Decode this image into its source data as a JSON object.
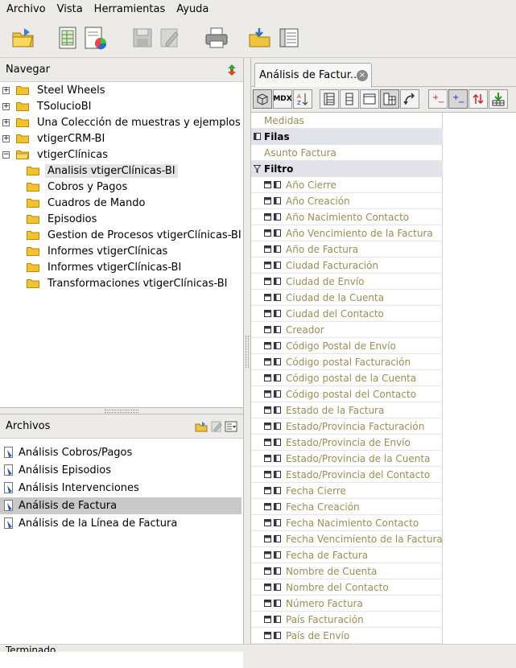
{
  "menubar": {
    "items": [
      "Archivo",
      "Vista",
      "Herramientas",
      "Ayuda"
    ]
  },
  "toolbar": {
    "icons": [
      "open-folder-icon",
      "new-report-icon",
      "new-analysis-icon",
      "save-icon",
      "edit-icon",
      "print-icon",
      "publish-icon",
      "view-icon"
    ]
  },
  "navigator": {
    "title": "Navegar",
    "tree": [
      {
        "label": "Steel Wheels",
        "level": 0,
        "expanded": false
      },
      {
        "label": "TSolucioBI",
        "level": 0,
        "expanded": false
      },
      {
        "label": "Una Colección de muestras y ejemplos",
        "level": 0,
        "expanded": false
      },
      {
        "label": "vtigerCRM-BI",
        "level": 0,
        "expanded": false
      },
      {
        "label": "vtigerClínicas",
        "level": 0,
        "expanded": true
      },
      {
        "label": "Analisis vtigerClínicas-BI",
        "level": 1,
        "selected": true
      },
      {
        "label": "Cobros y Pagos",
        "level": 1
      },
      {
        "label": "Cuadros de Mando",
        "level": 1
      },
      {
        "label": "Episodios",
        "level": 1
      },
      {
        "label": "Gestion de Procesos vtigerClínicas-BI",
        "level": 1
      },
      {
        "label": "Informes vtigerClínicas",
        "level": 1
      },
      {
        "label": "Informes vtigerClínicas-BI",
        "level": 1
      },
      {
        "label": "Transformaciones vtigerClínicas-BI",
        "level": 1
      }
    ]
  },
  "files": {
    "title": "Archivos",
    "items": [
      {
        "label": "Análisis Cobros/Pagos"
      },
      {
        "label": "Análisis Episodios"
      },
      {
        "label": "Análisis Intervenciones"
      },
      {
        "label": "Análisis de Factura",
        "selected": true
      },
      {
        "label": "Análisis de la Línea de Factura"
      }
    ]
  },
  "tab": {
    "label": "Análisis de Factur.."
  },
  "analysis_toolbar": {
    "mdx_label": "MDX"
  },
  "grid": {
    "medidas": "Medidas",
    "filas_header": "Filas",
    "filas_item": "Asunto Factura",
    "filtro_header": "Filtro",
    "filter_items": [
      "Año Cierre",
      "Año Creación",
      "Año Nacimiento Contacto",
      "Año Vencimiento de la Factura",
      "Año de Factura",
      "Ciudad Facturación",
      "Ciudad de Envío",
      "Ciudad de la Cuenta",
      "Ciudad del Contacto",
      "Creador",
      "Código Postal de Envío",
      "Código postal Facturación",
      "Código postal de la Cuenta",
      "Código postal del Contacto",
      "Estado de la Factura",
      "Estado/Provincia Facturación",
      "Estado/Provincia de Envío",
      "Estado/Provincia de la Cuenta",
      "Estado/Provincia del Contacto",
      "Fecha Cierre",
      "Fecha Creación",
      "Fecha Nacimiento Contacto",
      "Fecha Vencimiento de la Factura",
      "Fecha de Factura",
      "Nombre de Cuenta",
      "Nombre del Contacto",
      "Número Factura",
      "País Facturación",
      "País de Envío"
    ]
  },
  "status": {
    "text": "Terminado"
  }
}
